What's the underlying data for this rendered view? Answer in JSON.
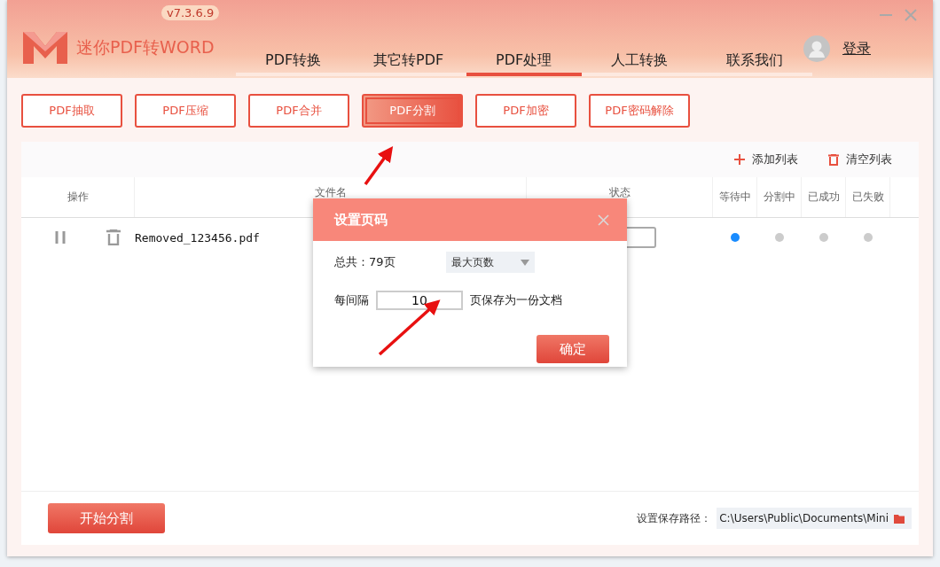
{
  "app": {
    "version": "v7.3.6.9",
    "title": "迷你PDF转WORD",
    "login": "登录"
  },
  "nav_tabs": [
    {
      "label": "PDF转换",
      "selected": false
    },
    {
      "label": "其它转PDF",
      "selected": false
    },
    {
      "label": "PDF处理",
      "selected": true
    },
    {
      "label": "人工转换",
      "selected": false
    },
    {
      "label": "联系我们",
      "selected": false
    }
  ],
  "tools": [
    {
      "label": "PDF抽取",
      "selected": false
    },
    {
      "label": "PDF压缩",
      "selected": false
    },
    {
      "label": "PDF合并",
      "selected": false
    },
    {
      "label": "PDF分割",
      "selected": true
    },
    {
      "label": "PDF加密",
      "selected": false
    },
    {
      "label": "PDF密码解除",
      "selected": false
    }
  ],
  "list_actions": [
    {
      "kind": "add",
      "label": "添加列表"
    },
    {
      "kind": "clear",
      "label": "清空列表"
    }
  ],
  "table": {
    "columns": [
      "操作",
      "文件名",
      "状态",
      "等待中",
      "分割中",
      "已成功",
      "已失败"
    ],
    "rows": [
      {
        "file": "Removed_123456.pdf",
        "stages": [
          {
            "active": true
          },
          {
            "active": false
          },
          {
            "active": false
          },
          {
            "active": false
          }
        ]
      }
    ]
  },
  "dialog": {
    "title": "设置页码",
    "total": "总共：79页",
    "mode": "最大页数",
    "interval_label": "每间隔",
    "interval_value": "10",
    "suffix": "页保存为一份文档",
    "ok": "确定"
  },
  "footer": {
    "start": "开始分割",
    "path_label": "设置保存路径：",
    "path": "C:\\Users\\Public\\Documents\\Mini"
  }
}
